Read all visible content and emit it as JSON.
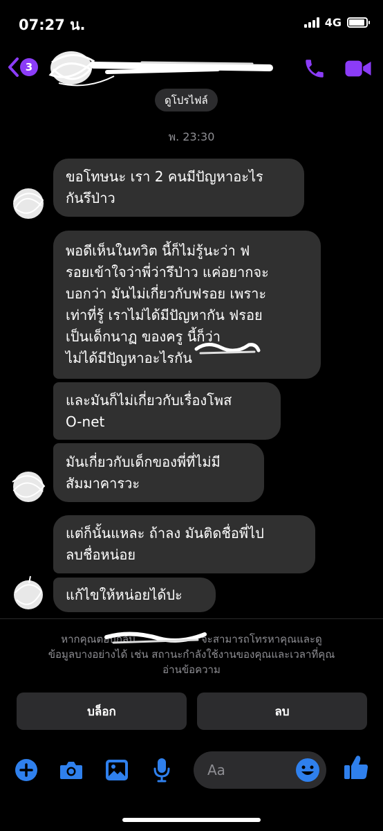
{
  "status_bar": {
    "time": "07:27 น.",
    "network": "4G"
  },
  "header": {
    "unread_count": "3"
  },
  "profile_button": "ดูโปรไฟล์",
  "timestamp": "พ. 23:30",
  "messages": [
    "ขอโทษนะ เรา 2 คนมีปัญหาอะไร\nกันรึป่าว",
    "พอดีเห็นในทวิต นี้ก็ไม่รู้นะว่า ฟ\nรอยเข้าใจว่าพี่ว่ารึป่าว  แค่อยากจะ\nบอกว่า มันไม่เกี่ยวกับฟรอย เพราะ\nเท่าที่รู้ เราไม่ได้มีปัญหากัน ฟรอย\nเป็นเด็กนาฏ ของครู           นี้ก็ว่า\nไม่ได้มีปัญหาอะไรกัน",
    "และมันก็ไม่เกี่ยวกับเรื่องโพส\nO-net",
    "มันเกี่ยวกับเด็กของพี่ที่ไม่มี\nสัมมาคารวะ",
    "แต่ก็นั้นแหละ ถ้าลง มันติดชื่อพี่ไป\nลบชื่อหน่อย",
    "แก้ไขให้หน่อยได้ปะ"
  ],
  "notice": {
    "line1": "หากคุณตอบกลับ                    จะสามารถโทรหาคุณและดู",
    "line2": "ข้อมูลบางอย่างได้ เช่น สถานะกำลังใช้งานของคุณและเวลาที่คุณ",
    "line3": "อ่านข้อความ"
  },
  "actions": {
    "block": "บล็อก",
    "delete": "ลบ"
  },
  "composer": {
    "placeholder": "Aa"
  },
  "colors": {
    "accent": "#8b3cf7",
    "composer_blue": "#2f80ed",
    "bubble": "#303030"
  }
}
